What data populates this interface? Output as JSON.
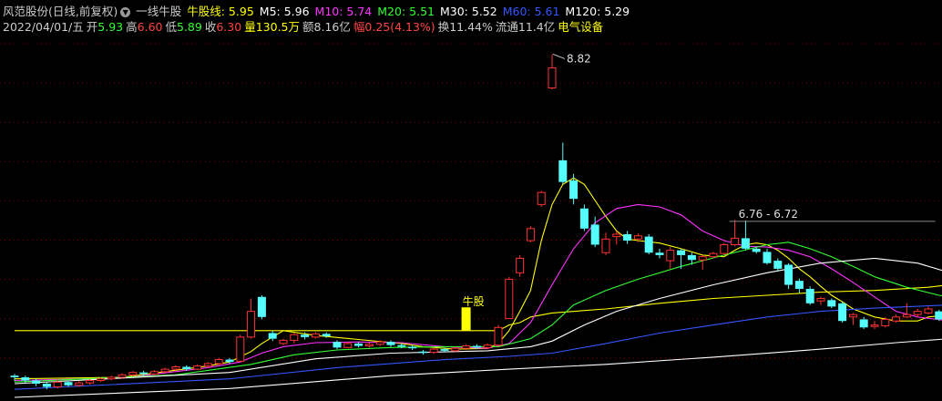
{
  "header": {
    "stock_title": "风范股份(日线,前复权)",
    "indicator_name": "一线牛股",
    "ma_items": [
      {
        "label": "牛股线:",
        "value": "5.95",
        "color": "#ffff00"
      },
      {
        "label": "M5:",
        "value": "5.96",
        "color": "#ffffff"
      },
      {
        "label": "M10:",
        "value": "5.74",
        "color": "#ff33ff"
      },
      {
        "label": "M20:",
        "value": "5.51",
        "color": "#33ff33"
      },
      {
        "label": "M30:",
        "value": "5.52",
        "color": "#ffffff"
      },
      {
        "label": "M60:",
        "value": "5.61",
        "color": "#3355ff"
      },
      {
        "label": "M120:",
        "value": "5.29",
        "color": "#ffffff"
      }
    ],
    "quote_items": [
      {
        "label": "2022/04/01/五",
        "value": "",
        "lcolor": "#cccccc",
        "vcolor": "#cccccc"
      },
      {
        "label": "开",
        "value": "5.93",
        "lcolor": "#cccccc",
        "vcolor": "#33ff33"
      },
      {
        "label": "高",
        "value": "6.60",
        "lcolor": "#cccccc",
        "vcolor": "#ff4444"
      },
      {
        "label": "低",
        "value": "5.89",
        "lcolor": "#cccccc",
        "vcolor": "#33ff33"
      },
      {
        "label": "收",
        "value": "6.30",
        "lcolor": "#cccccc",
        "vcolor": "#ff4444"
      },
      {
        "label": "量",
        "value": "130.5万",
        "lcolor": "#ffff00",
        "vcolor": "#ffff00"
      },
      {
        "label": "额",
        "value": "8.16亿",
        "lcolor": "#cccccc",
        "vcolor": "#cccccc"
      },
      {
        "label": "幅",
        "value": "0.25(4.13%)",
        "lcolor": "#ff4444",
        "vcolor": "#ff4444"
      },
      {
        "label": "换",
        "value": "11.44%",
        "lcolor": "#cccccc",
        "vcolor": "#cccccc"
      },
      {
        "label": "流通",
        "value": "11.4亿",
        "lcolor": "#cccccc",
        "vcolor": "#cccccc"
      },
      {
        "label": "电气设备",
        "value": "",
        "lcolor": "#ffff00",
        "vcolor": "#ffff00"
      }
    ]
  },
  "colors": {
    "up": "#ff3232",
    "down": "#54fcfc",
    "signal": "#ffff00",
    "grid": "#7a0000"
  },
  "chart_data": {
    "type": "candlestick",
    "ylim": [
      4.55,
      8.95
    ],
    "annotations": {
      "high_label": "8.82",
      "range_label": "6.76 - 6.72",
      "signal_label": "牛股"
    },
    "candles": [
      [
        4.82,
        4.8,
        4.84,
        4.75
      ],
      [
        4.8,
        4.76,
        4.82,
        4.73
      ],
      [
        4.76,
        4.72,
        4.78,
        4.69
      ],
      [
        4.72,
        4.68,
        4.74,
        4.65
      ],
      [
        4.68,
        4.74,
        4.77,
        4.66
      ],
      [
        4.74,
        4.7,
        4.76,
        4.68
      ],
      [
        4.7,
        4.73,
        4.75,
        4.68
      ],
      [
        4.73,
        4.76,
        4.78,
        4.71
      ],
      [
        4.76,
        4.78,
        4.8,
        4.74
      ],
      [
        4.78,
        4.8,
        4.82,
        4.76
      ],
      [
        4.8,
        4.83,
        4.85,
        4.78
      ],
      [
        4.83,
        4.86,
        4.88,
        4.81
      ],
      [
        4.86,
        4.84,
        4.88,
        4.82
      ],
      [
        4.84,
        4.87,
        4.89,
        4.82
      ],
      [
        4.87,
        4.9,
        4.92,
        4.85
      ],
      [
        4.9,
        4.93,
        4.95,
        4.88
      ],
      [
        4.93,
        4.9,
        4.95,
        4.88
      ],
      [
        4.9,
        4.94,
        4.96,
        4.89
      ],
      [
        4.94,
        4.97,
        4.99,
        4.92
      ],
      [
        4.97,
        5.02,
        5.04,
        4.95
      ],
      [
        5.02,
        4.99,
        5.04,
        4.97
      ],
      [
        5.0,
        5.3,
        5.33,
        4.99
      ],
      [
        5.3,
        5.62,
        5.78,
        5.28
      ],
      [
        5.8,
        5.55,
        5.82,
        5.52
      ],
      [
        5.35,
        5.28,
        5.38,
        5.25
      ],
      [
        5.22,
        5.26,
        5.28,
        5.2
      ],
      [
        5.26,
        5.33,
        5.35,
        5.22
      ],
      [
        5.33,
        5.3,
        5.36,
        5.27
      ],
      [
        5.3,
        5.34,
        5.36,
        5.28
      ],
      [
        5.34,
        5.31,
        5.36,
        5.29
      ],
      [
        5.24,
        5.17,
        5.26,
        5.15
      ],
      [
        5.17,
        5.22,
        5.24,
        5.16
      ],
      [
        5.22,
        5.19,
        5.24,
        5.17
      ],
      [
        5.19,
        5.21,
        5.23,
        5.17
      ],
      [
        5.21,
        5.24,
        5.26,
        5.19
      ],
      [
        5.24,
        5.2,
        5.26,
        5.18
      ],
      [
        5.2,
        5.18,
        5.22,
        5.16
      ],
      [
        5.18,
        5.16,
        5.2,
        5.14
      ],
      [
        5.12,
        5.11,
        5.14,
        5.08
      ],
      [
        5.11,
        5.15,
        5.17,
        5.09
      ],
      [
        5.15,
        5.13,
        5.17,
        5.11
      ],
      [
        5.13,
        5.16,
        5.18,
        5.11
      ],
      [
        5.16,
        5.19,
        5.21,
        5.14
      ],
      [
        5.19,
        5.17,
        5.21,
        5.15
      ],
      [
        5.17,
        5.2,
        5.22,
        5.15
      ],
      [
        5.2,
        5.42,
        5.45,
        5.18
      ],
      [
        5.53,
        6.02,
        6.05,
        5.53
      ],
      [
        6.1,
        6.28,
        6.32,
        6.05
      ],
      [
        6.5,
        6.65,
        6.68,
        6.48
      ],
      [
        6.95,
        7.1,
        7.12,
        6.92
      ],
      [
        8.4,
        8.65,
        8.82,
        8.38
      ],
      [
        7.5,
        7.23,
        7.72,
        7.2
      ],
      [
        7.25,
        7.02,
        7.33,
        6.95
      ],
      [
        6.9,
        6.65,
        6.95,
        6.62
      ],
      [
        6.7,
        6.45,
        6.8,
        6.42
      ],
      [
        6.35,
        6.52,
        6.6,
        6.32
      ],
      [
        6.55,
        6.58,
        6.62,
        6.45
      ],
      [
        6.58,
        6.5,
        6.62,
        6.46
      ],
      [
        6.52,
        6.56,
        6.59,
        6.48
      ],
      [
        6.55,
        6.35,
        6.58,
        6.33
      ],
      [
        6.35,
        6.32,
        6.4,
        6.28
      ],
      [
        6.25,
        6.38,
        6.42,
        6.15
      ],
      [
        6.38,
        6.32,
        6.4,
        6.15
      ],
      [
        6.32,
        6.26,
        6.35,
        6.2
      ],
      [
        6.26,
        6.3,
        6.32,
        6.14
      ],
      [
        6.3,
        6.34,
        6.36,
        6.28
      ],
      [
        6.34,
        6.45,
        6.47,
        6.32
      ],
      [
        6.45,
        6.53,
        6.76,
        6.43
      ],
      [
        6.53,
        6.4,
        6.75,
        6.38
      ],
      [
        6.4,
        6.36,
        6.42,
        6.34
      ],
      [
        6.36,
        6.22,
        6.4,
        6.2
      ],
      [
        6.25,
        6.15,
        6.28,
        6.12
      ],
      [
        6.2,
        5.95,
        6.22,
        5.9
      ],
      [
        6.0,
        5.9,
        6.03,
        5.85
      ],
      [
        5.9,
        5.72,
        5.93,
        5.7
      ],
      [
        5.75,
        5.78,
        5.8,
        5.7
      ],
      [
        5.76,
        5.68,
        5.78,
        5.66
      ],
      [
        5.72,
        5.5,
        5.74,
        5.48
      ],
      [
        5.55,
        5.58,
        5.6,
        5.45
      ],
      [
        5.52,
        5.42,
        5.55,
        5.4
      ],
      [
        5.44,
        5.45,
        5.5,
        5.4
      ],
      [
        5.44,
        5.52,
        5.55,
        5.42
      ],
      [
        5.5,
        5.55,
        5.58,
        5.48
      ],
      [
        5.55,
        5.58,
        5.72,
        5.54
      ],
      [
        5.58,
        5.62,
        5.65,
        5.55
      ],
      [
        5.6,
        5.65,
        5.68,
        5.58
      ],
      [
        5.62,
        5.52,
        5.64,
        5.5
      ],
      [
        5.52,
        5.55,
        5.57,
        5.5
      ]
    ],
    "series": [
      {
        "name": "牛股线",
        "color": "#ffff00",
        "values": [
          [
            0,
            5.38
          ],
          [
            40,
            5.38
          ],
          [
            44,
            5.38
          ],
          [
            45,
            5.38
          ],
          [
            46,
            5.45
          ],
          [
            47,
            5.48
          ],
          [
            48,
            5.55
          ],
          [
            50,
            5.6
          ],
          [
            55,
            5.65
          ],
          [
            60,
            5.72
          ],
          [
            65,
            5.78
          ],
          [
            70,
            5.82
          ],
          [
            75,
            5.86
          ],
          [
            80,
            5.88
          ],
          [
            85,
            5.92
          ],
          [
            87,
            5.95
          ]
        ]
      },
      {
        "name": "M5",
        "color": "#ffff00",
        "values": [
          [
            0,
            4.78
          ],
          [
            10,
            4.8
          ],
          [
            18,
            4.94
          ],
          [
            20,
            4.99
          ],
          [
            22,
            5.12
          ],
          [
            23,
            5.22
          ],
          [
            25,
            5.38
          ],
          [
            28,
            5.32
          ],
          [
            32,
            5.27
          ],
          [
            36,
            5.22
          ],
          [
            38,
            5.18
          ],
          [
            41,
            5.15
          ],
          [
            44,
            5.16
          ],
          [
            45,
            5.22
          ],
          [
            46,
            5.38
          ],
          [
            47,
            5.62
          ],
          [
            48,
            5.88
          ],
          [
            49,
            6.5
          ],
          [
            50,
            6.95
          ],
          [
            51,
            7.2
          ],
          [
            52,
            7.28
          ],
          [
            53,
            7.2
          ],
          [
            54,
            7.0
          ],
          [
            55,
            6.8
          ],
          [
            56,
            6.62
          ],
          [
            57,
            6.52
          ],
          [
            58,
            6.5
          ],
          [
            60,
            6.47
          ],
          [
            62,
            6.4
          ],
          [
            64,
            6.32
          ],
          [
            66,
            6.3
          ],
          [
            67,
            6.38
          ],
          [
            68,
            6.45
          ],
          [
            69,
            6.47
          ],
          [
            70,
            6.45
          ],
          [
            71,
            6.38
          ],
          [
            72,
            6.28
          ],
          [
            73,
            6.15
          ],
          [
            74,
            6.05
          ],
          [
            75,
            5.93
          ],
          [
            76,
            5.82
          ],
          [
            77,
            5.74
          ],
          [
            78,
            5.65
          ],
          [
            80,
            5.55
          ],
          [
            82,
            5.5
          ],
          [
            84,
            5.5
          ],
          [
            85,
            5.55
          ],
          [
            87,
            5.58
          ]
        ]
      },
      {
        "name": "M10",
        "color": "#ff33ff",
        "values": [
          [
            0,
            4.76
          ],
          [
            10,
            4.79
          ],
          [
            18,
            4.92
          ],
          [
            21,
            4.99
          ],
          [
            23,
            5.1
          ],
          [
            25,
            5.18
          ],
          [
            28,
            5.23
          ],
          [
            32,
            5.24
          ],
          [
            36,
            5.23
          ],
          [
            40,
            5.18
          ],
          [
            44,
            5.16
          ],
          [
            46,
            5.22
          ],
          [
            48,
            5.48
          ],
          [
            50,
            5.95
          ],
          [
            52,
            6.4
          ],
          [
            54,
            6.72
          ],
          [
            56,
            6.9
          ],
          [
            58,
            6.95
          ],
          [
            60,
            6.92
          ],
          [
            62,
            6.82
          ],
          [
            64,
            6.62
          ],
          [
            66,
            6.5
          ],
          [
            68,
            6.43
          ],
          [
            70,
            6.42
          ],
          [
            72,
            6.38
          ],
          [
            74,
            6.3
          ],
          [
            76,
            6.15
          ],
          [
            78,
            5.98
          ],
          [
            80,
            5.8
          ],
          [
            82,
            5.62
          ],
          [
            84,
            5.55
          ],
          [
            87,
            5.5
          ]
        ]
      },
      {
        "name": "M20",
        "color": "#33ff33",
        "values": [
          [
            0,
            4.74
          ],
          [
            15,
            4.83
          ],
          [
            22,
            4.96
          ],
          [
            26,
            5.08
          ],
          [
            30,
            5.14
          ],
          [
            35,
            5.17
          ],
          [
            40,
            5.18
          ],
          [
            45,
            5.18
          ],
          [
            48,
            5.28
          ],
          [
            50,
            5.45
          ],
          [
            52,
            5.7
          ],
          [
            55,
            5.88
          ],
          [
            58,
            6.02
          ],
          [
            62,
            6.18
          ],
          [
            66,
            6.32
          ],
          [
            70,
            6.45
          ],
          [
            72,
            6.48
          ],
          [
            74,
            6.4
          ],
          [
            76,
            6.3
          ],
          [
            78,
            6.18
          ],
          [
            80,
            6.05
          ],
          [
            83,
            5.92
          ],
          [
            86,
            5.82
          ],
          [
            87,
            5.8
          ]
        ]
      },
      {
        "name": "M30",
        "color": "#ffffff",
        "values": [
          [
            0,
            4.72
          ],
          [
            20,
            4.86
          ],
          [
            28,
            5.03
          ],
          [
            35,
            5.1
          ],
          [
            44,
            5.13
          ],
          [
            48,
            5.18
          ],
          [
            50,
            5.25
          ],
          [
            53,
            5.45
          ],
          [
            56,
            5.62
          ],
          [
            60,
            5.78
          ],
          [
            65,
            5.95
          ],
          [
            70,
            6.1
          ],
          [
            75,
            6.22
          ],
          [
            80,
            6.28
          ],
          [
            84,
            6.22
          ],
          [
            87,
            6.1
          ]
        ]
      },
      {
        "name": "M60",
        "color": "#3355ff",
        "values": [
          [
            0,
            4.65
          ],
          [
            20,
            4.78
          ],
          [
            30,
            4.92
          ],
          [
            40,
            5.02
          ],
          [
            46,
            5.06
          ],
          [
            50,
            5.1
          ],
          [
            55,
            5.22
          ],
          [
            60,
            5.35
          ],
          [
            65,
            5.45
          ],
          [
            70,
            5.55
          ],
          [
            75,
            5.62
          ],
          [
            80,
            5.66
          ],
          [
            87,
            5.7
          ]
        ]
      },
      {
        "name": "M120",
        "color": "#ffffff",
        "values": [
          [
            0,
            4.55
          ],
          [
            20,
            4.66
          ],
          [
            35,
            4.82
          ],
          [
            46,
            4.9
          ],
          [
            55,
            4.96
          ],
          [
            65,
            5.05
          ],
          [
            75,
            5.15
          ],
          [
            82,
            5.23
          ],
          [
            87,
            5.28
          ]
        ]
      }
    ]
  }
}
